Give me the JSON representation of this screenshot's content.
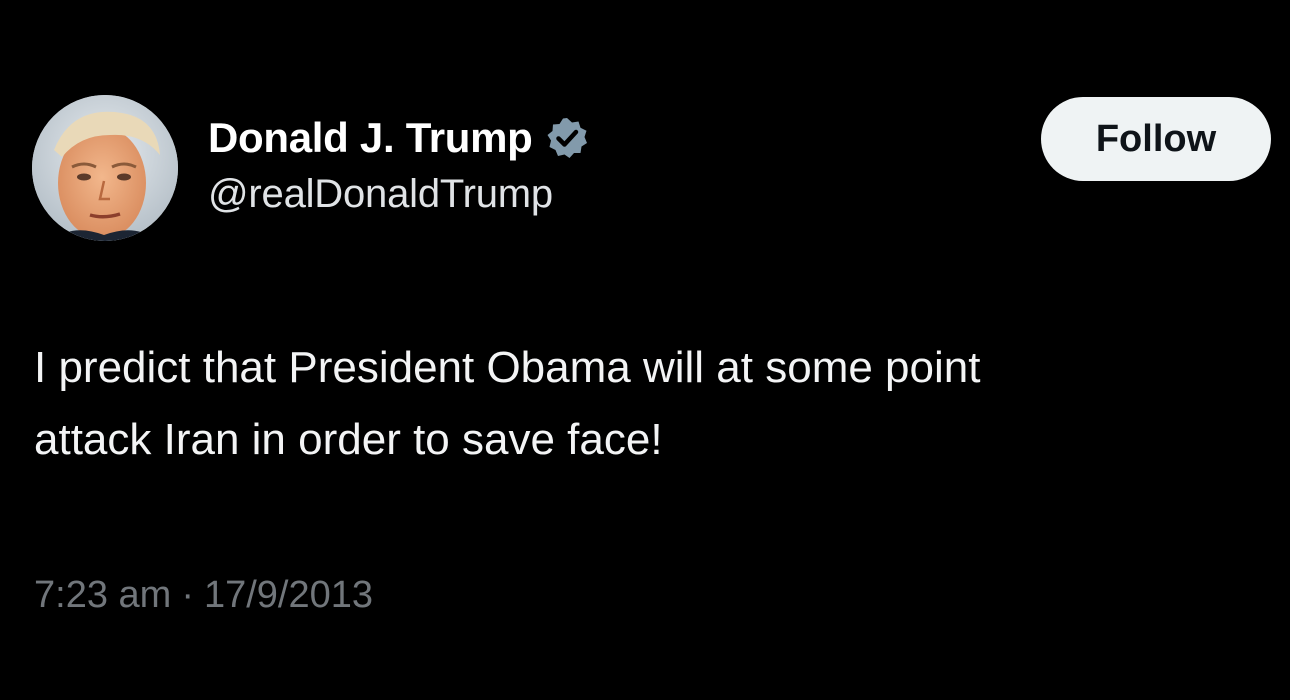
{
  "author": {
    "display_name": "Donald J. Trump",
    "handle": "@realDonaldTrump",
    "verified": true,
    "avatar_icon": "profile-photo"
  },
  "follow_button": {
    "label": "Follow"
  },
  "tweet": {
    "lines": [
      "I predict that President Obama will at some point",
      "attack Iran in order to save face!"
    ]
  },
  "meta": {
    "time": "7:23 am",
    "separator": "·",
    "date": "17/9/2013"
  },
  "colors": {
    "background": "#000000",
    "text": "#e7e9ea",
    "muted": "#71767b",
    "verified_badge": "#829aab",
    "button_bg": "#eff3f4",
    "button_text": "#0f1419"
  }
}
